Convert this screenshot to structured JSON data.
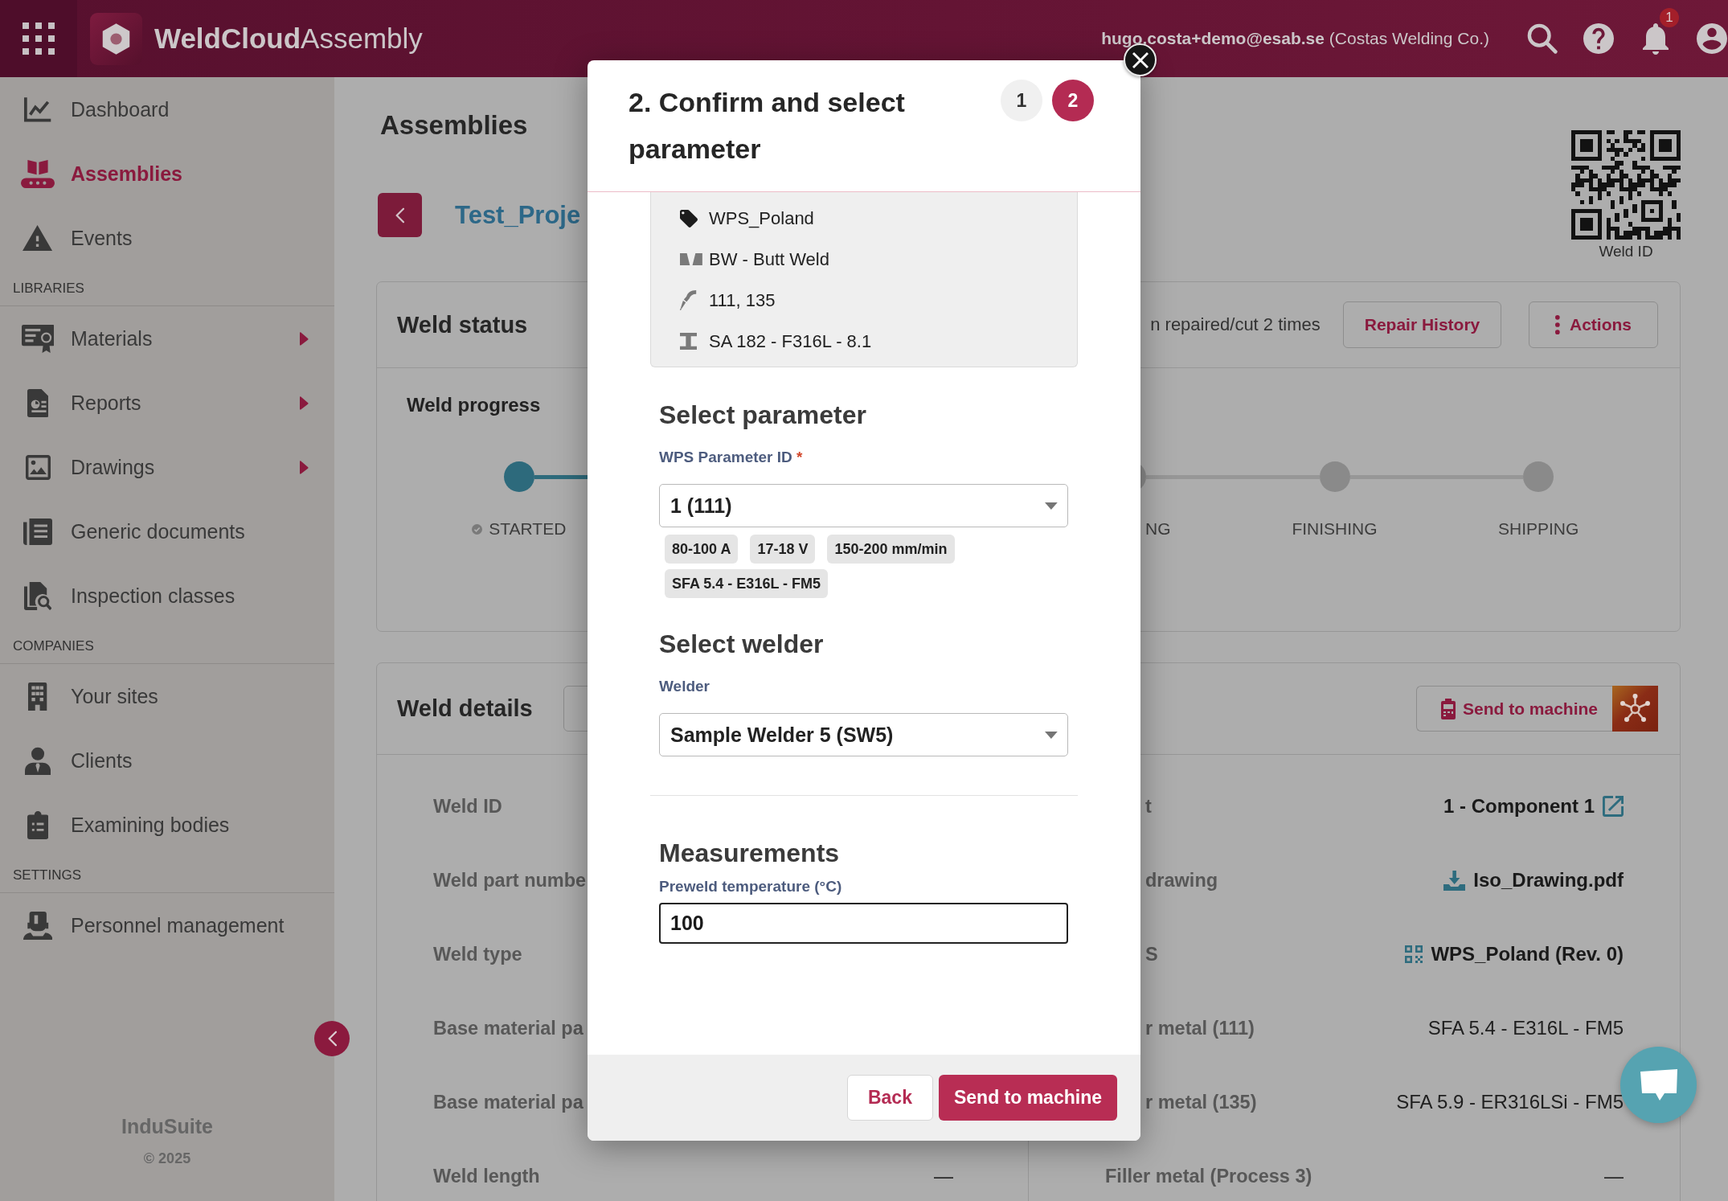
{
  "app_bar": {
    "title": "**WeldCloud**Assembly",
    "user": "**hugo.costa+demo@esab.se** (Costas Welding Co.)",
    "notification_count": "1"
  },
  "sidebar": {
    "groups": [
      {
        "items": [
          {
            "label": "Dashboard",
            "selected": false,
            "expandable": false
          },
          {
            "label": "Assemblies",
            "selected": true,
            "expandable": false
          },
          {
            "label": "Events",
            "selected": false,
            "expandable": false
          }
        ]
      },
      {
        "heading": "LIBRARIES",
        "items": [
          {
            "label": "Materials",
            "selected": false,
            "expandable": true
          },
          {
            "label": "Reports",
            "selected": false,
            "expandable": true
          },
          {
            "label": "Drawings",
            "selected": false,
            "expandable": true
          },
          {
            "label": "Generic documents",
            "selected": false,
            "expandable": false
          },
          {
            "label": "Inspection classes",
            "selected": false,
            "expandable": false
          }
        ]
      },
      {
        "heading": "COMPANIES",
        "items": [
          {
            "label": "Your sites",
            "selected": false,
            "expandable": false
          },
          {
            "label": "Clients",
            "selected": false,
            "expandable": false
          },
          {
            "label": "Examining bodies",
            "selected": false,
            "expandable": false
          }
        ]
      },
      {
        "heading": "SETTINGS",
        "items": [
          {
            "label": "Personnel management",
            "selected": false,
            "expandable": false
          }
        ]
      }
    ],
    "footer": {
      "brand": "InduSuite",
      "copyright": "© 2025"
    }
  },
  "page": {
    "title": "Assemblies",
    "breadcrumb": "Test_Proje",
    "qr_caption": "Weld ID"
  },
  "weld_status": {
    "title": "Weld status",
    "repair_note": "n repaired/cut 2 times",
    "buttons": [
      {
        "label": "Repair History",
        "kind": "plain"
      },
      {
        "label": "Actions",
        "kind": "menu"
      }
    ],
    "progress_title": "Weld progress",
    "stages": [
      {
        "label": "STARTED",
        "reached": true
      },
      {
        "label": "NG",
        "reached": false
      },
      {
        "label": "FINISHING",
        "reached": false
      },
      {
        "label": "SHIPPING",
        "reached": false
      }
    ]
  },
  "weld_details": {
    "title": "Weld details",
    "send_button": "Send to machine",
    "left_rows": [
      {
        "label": "Weld ID"
      },
      {
        "label": "Weld part numbe"
      },
      {
        "label": "Weld type"
      },
      {
        "label": "Base material pa"
      },
      {
        "label": "Base material pa"
      },
      {
        "label": "Weld length",
        "value": "—"
      }
    ],
    "right_rows": [
      {
        "label": "t",
        "value": "1 - Component 1",
        "kind": "external_link"
      },
      {
        "label": "drawing",
        "value": "Iso_Drawing.pdf",
        "kind": "download"
      },
      {
        "label": "S",
        "value": "WPS_Poland (Rev. 0)",
        "kind": "wps"
      },
      {
        "label": "r metal (111)",
        "value": "SFA 5.4 - E316L - FM5",
        "kind": "plain"
      },
      {
        "label": "r metal (135)",
        "value": "SFA 5.9 - ER316LSi - FM5",
        "kind": "plain"
      },
      {
        "label": "Filler metal (Process 3)",
        "value": "—",
        "kind": "plain"
      }
    ]
  },
  "dialog": {
    "title": "2. Confirm and select parameter",
    "steps": [
      {
        "label": "1",
        "selected": false
      },
      {
        "label": "2",
        "selected": true
      }
    ],
    "summary": [
      "WPS_Poland",
      "BW - Butt Weld",
      "111, 135",
      "SA 182 - F316L - 8.1"
    ],
    "parameter_section": {
      "title": "Select parameter",
      "label": "WPS Parameter ID",
      "required_mark": "*",
      "value": "1 (111)",
      "chips": [
        "80-100 A",
        "17-18 V",
        "150-200 mm/min",
        "SFA 5.4 - E316L - FM5"
      ]
    },
    "welder_section": {
      "title": "Select welder",
      "label": "Welder",
      "value": "Sample Welder 5 (SW5)"
    },
    "measurements": {
      "title": "Measurements",
      "label": "Preweld temperature (°C)",
      "value": "100"
    },
    "buttons": [
      {
        "label": "Back",
        "kind": "secondary"
      },
      {
        "label": "Send to machine",
        "kind": "primary"
      }
    ]
  }
}
